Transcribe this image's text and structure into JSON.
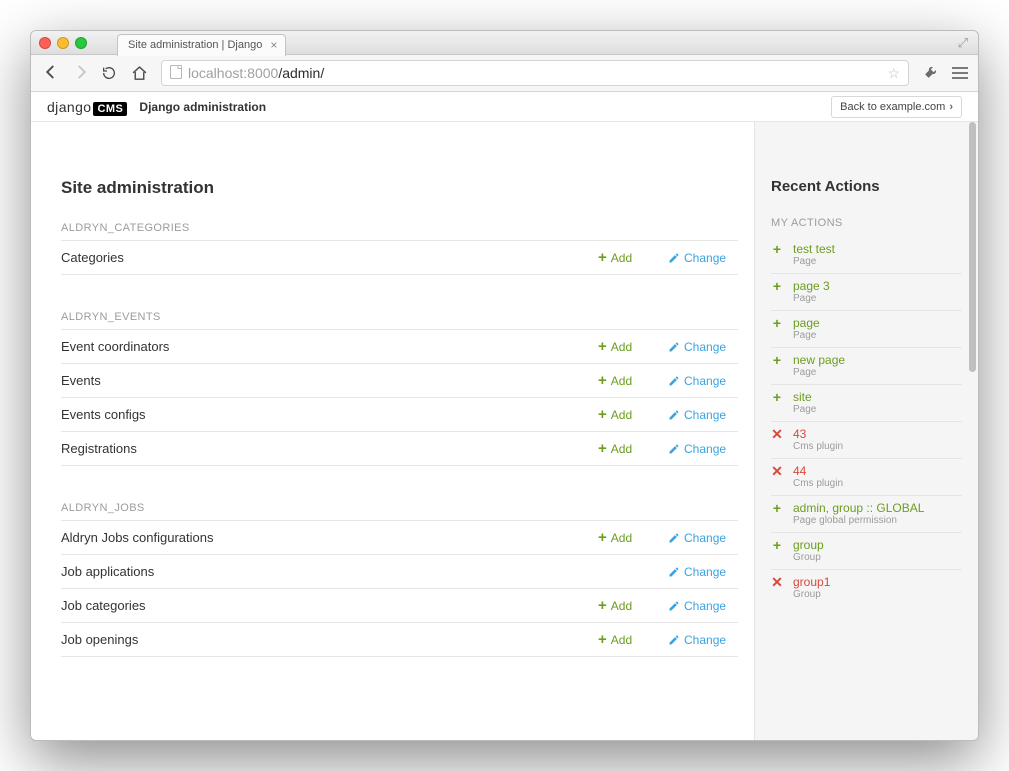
{
  "browser": {
    "tab_title": "Site administration | Django",
    "url_host": "localhost",
    "url_port": ":8000",
    "url_path": "/admin/"
  },
  "cms": {
    "logo_text": "django",
    "logo_badge": "CMS",
    "admin_label": "Django administration",
    "back_label": "Back to example.com"
  },
  "main": {
    "page_title": "Site administration",
    "add_label": "Add",
    "change_label": "Change",
    "apps": [
      {
        "caption": "ALDRYN_CATEGORIES",
        "models": [
          {
            "name": "Categories",
            "add": true,
            "change": true
          }
        ]
      },
      {
        "caption": "ALDRYN_EVENTS",
        "models": [
          {
            "name": "Event coordinators",
            "add": true,
            "change": true
          },
          {
            "name": "Events",
            "add": true,
            "change": true
          },
          {
            "name": "Events configs",
            "add": true,
            "change": true
          },
          {
            "name": "Registrations",
            "add": true,
            "change": true
          }
        ]
      },
      {
        "caption": "ALDRYN_JOBS",
        "models": [
          {
            "name": "Aldryn Jobs configurations",
            "add": true,
            "change": true
          },
          {
            "name": "Job applications",
            "add": false,
            "change": true
          },
          {
            "name": "Job categories",
            "add": true,
            "change": true
          },
          {
            "name": "Job openings",
            "add": true,
            "change": true
          }
        ]
      }
    ]
  },
  "sidebar": {
    "title": "Recent Actions",
    "subtitle": "MY ACTIONS",
    "actions": [
      {
        "kind": "add",
        "title": "test test",
        "sub": "Page"
      },
      {
        "kind": "add",
        "title": "page 3",
        "sub": "Page"
      },
      {
        "kind": "add",
        "title": "page",
        "sub": "Page"
      },
      {
        "kind": "add",
        "title": "new page",
        "sub": "Page"
      },
      {
        "kind": "add",
        "title": "site",
        "sub": "Page"
      },
      {
        "kind": "del",
        "title": "43",
        "sub": "Cms plugin"
      },
      {
        "kind": "del",
        "title": "44",
        "sub": "Cms plugin"
      },
      {
        "kind": "add",
        "title": "admin, group :: GLOBAL",
        "sub": "Page global permission"
      },
      {
        "kind": "add",
        "title": "group",
        "sub": "Group"
      },
      {
        "kind": "del",
        "title": "group1",
        "sub": "Group"
      }
    ]
  }
}
